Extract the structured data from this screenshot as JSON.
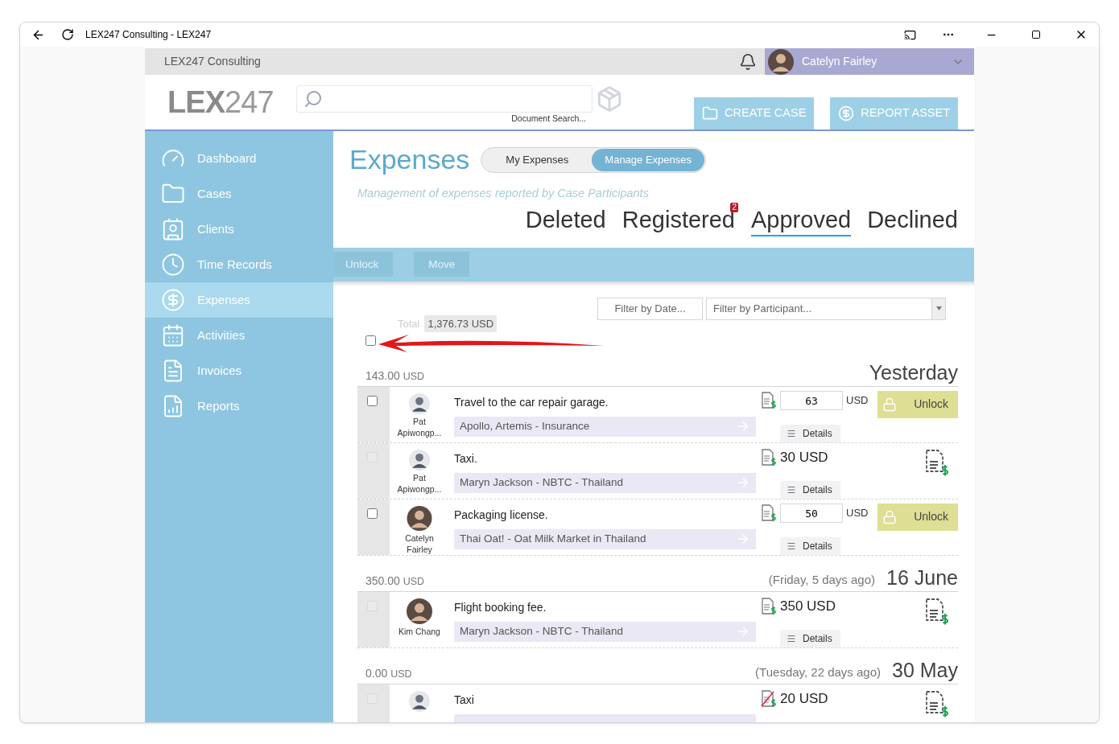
{
  "window": {
    "title": "LEX247 Consulting - LEX247"
  },
  "topbar": {
    "org": "LEX247 Consulting",
    "user": "Catelyn Fairley"
  },
  "header": {
    "logo_main": "LEX",
    "logo_num": "247",
    "search_caption": "Document Search...",
    "buttons": [
      {
        "label": "CREATE CASE",
        "kind": "folder"
      },
      {
        "label": "REPORT ASSET",
        "kind": "dollar"
      }
    ]
  },
  "sidebar": {
    "items": [
      {
        "label": "Dashboard",
        "selected": false
      },
      {
        "label": "Cases",
        "selected": false
      },
      {
        "label": "Clients",
        "selected": false
      },
      {
        "label": "Time Records",
        "selected": false
      },
      {
        "label": "Expenses",
        "selected": true
      },
      {
        "label": "Activities",
        "selected": false
      },
      {
        "label": "Invoices",
        "selected": false
      },
      {
        "label": "Reports",
        "selected": false
      }
    ]
  },
  "page": {
    "title": "Expenses",
    "toggle": [
      {
        "label": "My Expenses",
        "selected": false
      },
      {
        "label": "Manage Expenses",
        "selected": true
      }
    ],
    "subtitle": "Management of expenses reported by Case Participants",
    "tabs": [
      {
        "label": "Deleted",
        "selected": false
      },
      {
        "label": "Registered",
        "selected": false,
        "badge": "2"
      },
      {
        "label": "Approved",
        "selected": true
      },
      {
        "label": "Declined",
        "selected": false
      }
    ],
    "actions": [
      "Unlock",
      "Move"
    ],
    "filters": {
      "date_placeholder": "Filter by Date...",
      "participant_placeholder": "Filter by Participant..."
    },
    "total_label": "Total",
    "total": "1,376.73 USD",
    "select_all_checked": false
  },
  "groups": [
    {
      "amount": "143.00",
      "currency": "USD",
      "date": "Yesterday",
      "rows": [
        {
          "kind": "editable",
          "checked": false,
          "disabled": false,
          "person": "Pat Apiwongp...",
          "description": "Travel to the car repair garage.",
          "project": "Apollo, Artemis - Insurance",
          "amount": "63",
          "currency": "USD",
          "unlock": "Unlock",
          "details": "Details",
          "receipt_missing": false
        },
        {
          "kind": "locked",
          "checked": false,
          "disabled": true,
          "person": "Pat Apiwongp...",
          "description": "Taxi.",
          "project": "Maryn Jackson - NBTC - Thailand",
          "amount": "30 USD",
          "details": "Details",
          "receipt_missing": false
        },
        {
          "kind": "editable",
          "checked": false,
          "disabled": false,
          "person": "Catelyn Fairley",
          "description": "Packaging license.",
          "project": "Thai Oat! - Oat Milk Market in Thailand",
          "amount": "50",
          "currency": "USD",
          "unlock": "Unlock",
          "details": "Details",
          "receipt_missing": false
        }
      ]
    },
    {
      "amount": "350.00",
      "currency": "USD",
      "when": "(Friday, 5 days ago)",
      "date": "16 June",
      "rows": [
        {
          "kind": "locked",
          "checked": false,
          "disabled": true,
          "person": "Kim Chang",
          "description": "Flight booking fee.",
          "project": "Maryn Jackson - NBTC - Thailand",
          "amount": "350 USD",
          "details": "Details",
          "receipt_missing": false
        }
      ]
    },
    {
      "amount": "0.00",
      "currency": "USD",
      "when": "(Tuesday, 22 days ago)",
      "date": "30 May",
      "rows": [
        {
          "kind": "locked",
          "checked": false,
          "disabled": true,
          "description": "Taxi",
          "amount": "20 USD",
          "receipt_missing": true
        }
      ]
    }
  ]
}
